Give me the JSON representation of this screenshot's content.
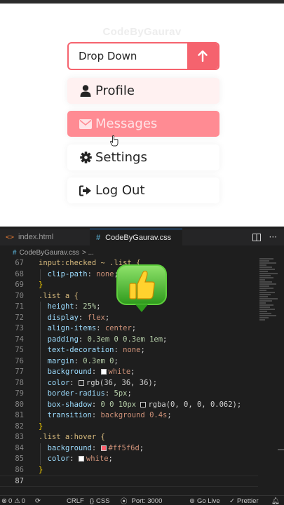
{
  "preview": {
    "watermark": "CodeByGaurav",
    "dropdown_label": "Drop Down",
    "menu": [
      {
        "label": "Profile",
        "icon": "user-icon"
      },
      {
        "label": "Messages",
        "icon": "envelope-icon"
      },
      {
        "label": "Settings",
        "icon": "gear-icon"
      },
      {
        "label": "Log Out",
        "icon": "sign-out-icon"
      }
    ],
    "colors": {
      "accent": "#f5636e",
      "hover_bg": "#ff5f6d",
      "text": "#242424"
    }
  },
  "editor": {
    "tabs": [
      {
        "label": "index.html",
        "icon": "html-file-icon"
      },
      {
        "label": "CodeByGaurav.css",
        "icon": "css-file-icon"
      }
    ],
    "breadcrumb": {
      "file": "CodeByGaurav.css",
      "trail": "> ..."
    },
    "lines": {
      "l67": {
        "n": "67",
        "a": "input:checked ~ .list {"
      },
      "l68": {
        "n": "68",
        "p": "clip-path",
        "v": "none",
        "e": ";"
      },
      "l69": {
        "n": "69",
        "a": "}"
      },
      "l70": {
        "n": "70",
        "a": ".list a {"
      },
      "l71": {
        "n": "71",
        "p": "height",
        "v": "25%",
        "e": ";"
      },
      "l72": {
        "n": "72",
        "p": "display",
        "v": "flex",
        "e": ";"
      },
      "l73": {
        "n": "73",
        "p": "align-items",
        "v": "center",
        "e": ";"
      },
      "l74": {
        "n": "74",
        "p": "padding",
        "v": "0.3em 0 0.3em 1em",
        "e": ";"
      },
      "l75": {
        "n": "75",
        "p": "text-decoration",
        "v": "none",
        "e": ";"
      },
      "l76": {
        "n": "76",
        "p": "margin",
        "v": "0.3em 0",
        "e": ";"
      },
      "l77": {
        "n": "77",
        "p": "background",
        "v": "white",
        "e": ";"
      },
      "l78": {
        "n": "78",
        "p": "color",
        "v": "rgb(36, 36, 36)",
        "e": ";"
      },
      "l79": {
        "n": "79",
        "p": "border-radius",
        "v": "5px",
        "e": ";"
      },
      "l80": {
        "n": "80",
        "p": "box-shadow",
        "v1": "0 0 10px",
        "v": "rgba(0, 0, 0, 0.062)",
        "e": ";"
      },
      "l81": {
        "n": "81",
        "p": "transition",
        "v": "background 0.4s",
        "e": ";"
      },
      "l82": {
        "n": "82",
        "a": "}"
      },
      "l83": {
        "n": "83",
        "a": ".list a:hover {"
      },
      "l84": {
        "n": "84",
        "p": "background",
        "v": "#ff5f6d",
        "e": ";"
      },
      "l85": {
        "n": "85",
        "p": "color",
        "v": "white",
        "e": ";"
      },
      "l86": {
        "n": "86",
        "a": "}"
      },
      "l87": {
        "n": "87",
        "a": ""
      }
    },
    "swatches": {
      "white": "#ffffff",
      "dark": "#242424",
      "shadow": "#101010",
      "hover": "#ff5f6d"
    }
  },
  "statusbar": {
    "problems": "0",
    "warnings": "0",
    "eol": "CRLF",
    "language": "{} CSS",
    "port": "Port: 3000",
    "live": "Go Live",
    "prettier": "Prettier"
  }
}
